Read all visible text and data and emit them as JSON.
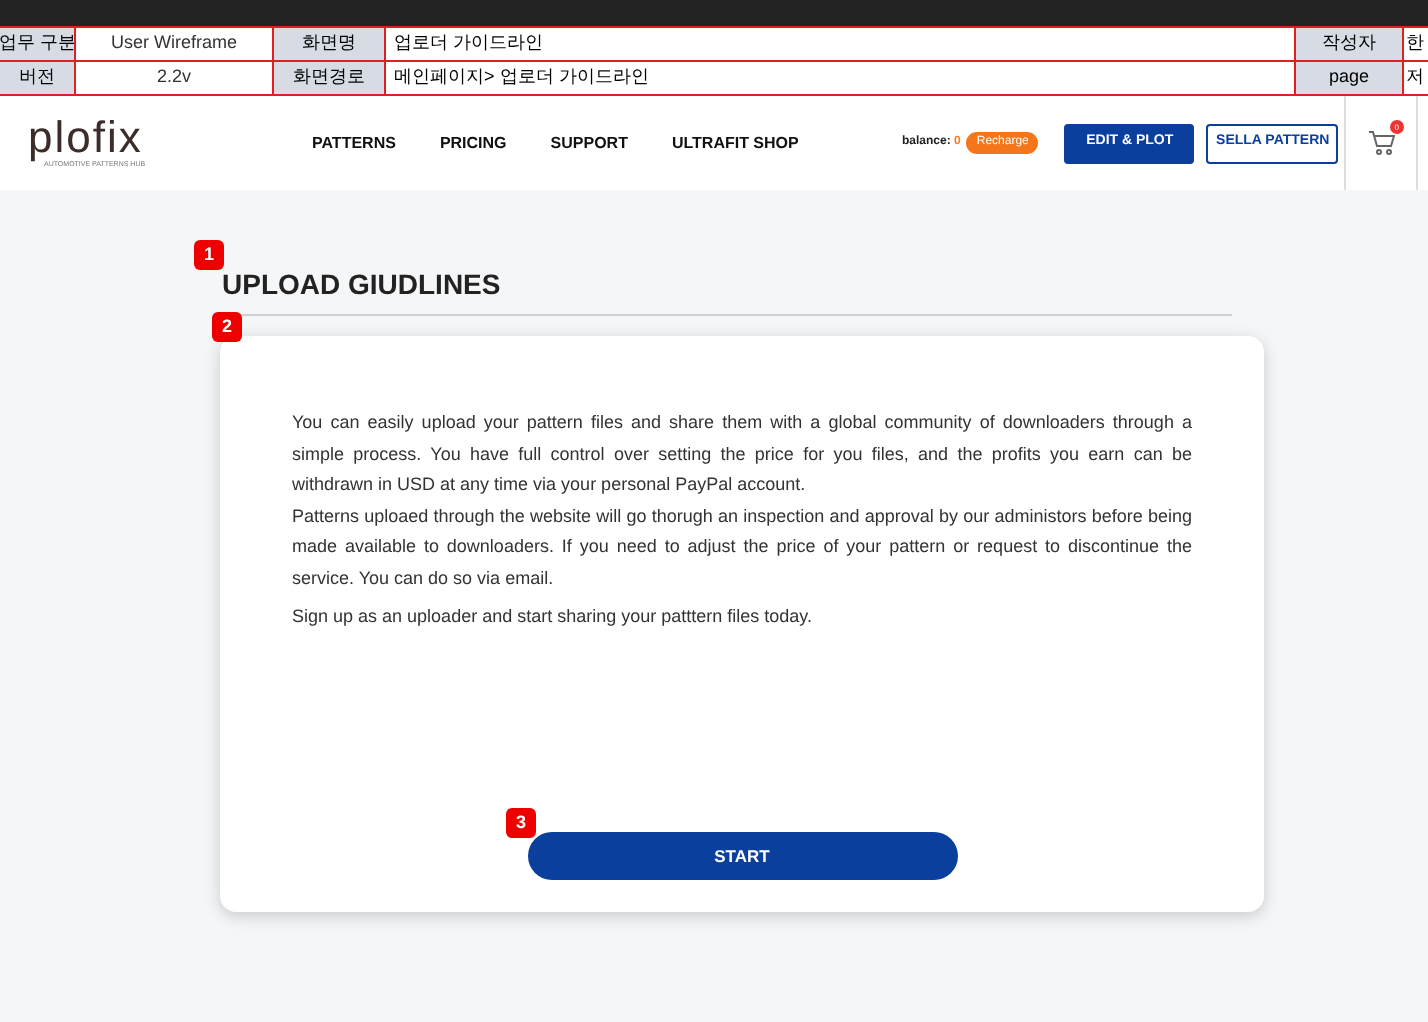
{
  "spec_table": {
    "rows": [
      {
        "cells": [
          {
            "kind": "label",
            "text": "업무 구분"
          },
          {
            "kind": "value",
            "text": "User Wireframe"
          },
          {
            "kind": "label",
            "text": "화면명"
          },
          {
            "kind": "wide",
            "text": "업로더 가이드라인"
          },
          {
            "kind": "label",
            "text": "작성자"
          },
          {
            "kind": "edge",
            "text": "한"
          }
        ]
      },
      {
        "cells": [
          {
            "kind": "label",
            "text": "버전"
          },
          {
            "kind": "value",
            "text": "2.2v"
          },
          {
            "kind": "label",
            "text": "화면경로"
          },
          {
            "kind": "wide",
            "text": "메인페이지> 업로더 가이드라인"
          },
          {
            "kind": "label",
            "text": "page"
          },
          {
            "kind": "edge",
            "text": "저"
          }
        ]
      }
    ]
  },
  "nav": {
    "logo": "plofix",
    "logo_tagline": "AUTOMOTIVE PATTERNS HUB",
    "links": [
      "PATTERNS",
      "PRICING",
      "SUPPORT",
      "ULTRAFIT SHOP"
    ],
    "balance_label": "balance:",
    "balance_value": "0",
    "recharge": "Recharge",
    "edit_button": "EDIT & PLOT",
    "sell_button": "SELLA PATTERN",
    "cart_count": "0"
  },
  "markers": [
    "1",
    "2",
    "3"
  ],
  "page": {
    "title": "UPLOAD GIUDLINES",
    "paragraphs": [
      "You can easily upload your pattern files and share them with a global community of downloaders through a simple process. You have full control over setting the price for you files, and the profits you earn can be withdrawn in USD at any time via your personal PayPal account.",
      "Patterns uploaed through the website will go thorugh an inspection and approval by our administors before being made available to downloaders. If you need to adjust the price of your pattern or request to discontinue the service. You can do so via email.",
      "Sign up as an uploader and start sharing your patttern files today."
    ],
    "start_button": "START"
  }
}
